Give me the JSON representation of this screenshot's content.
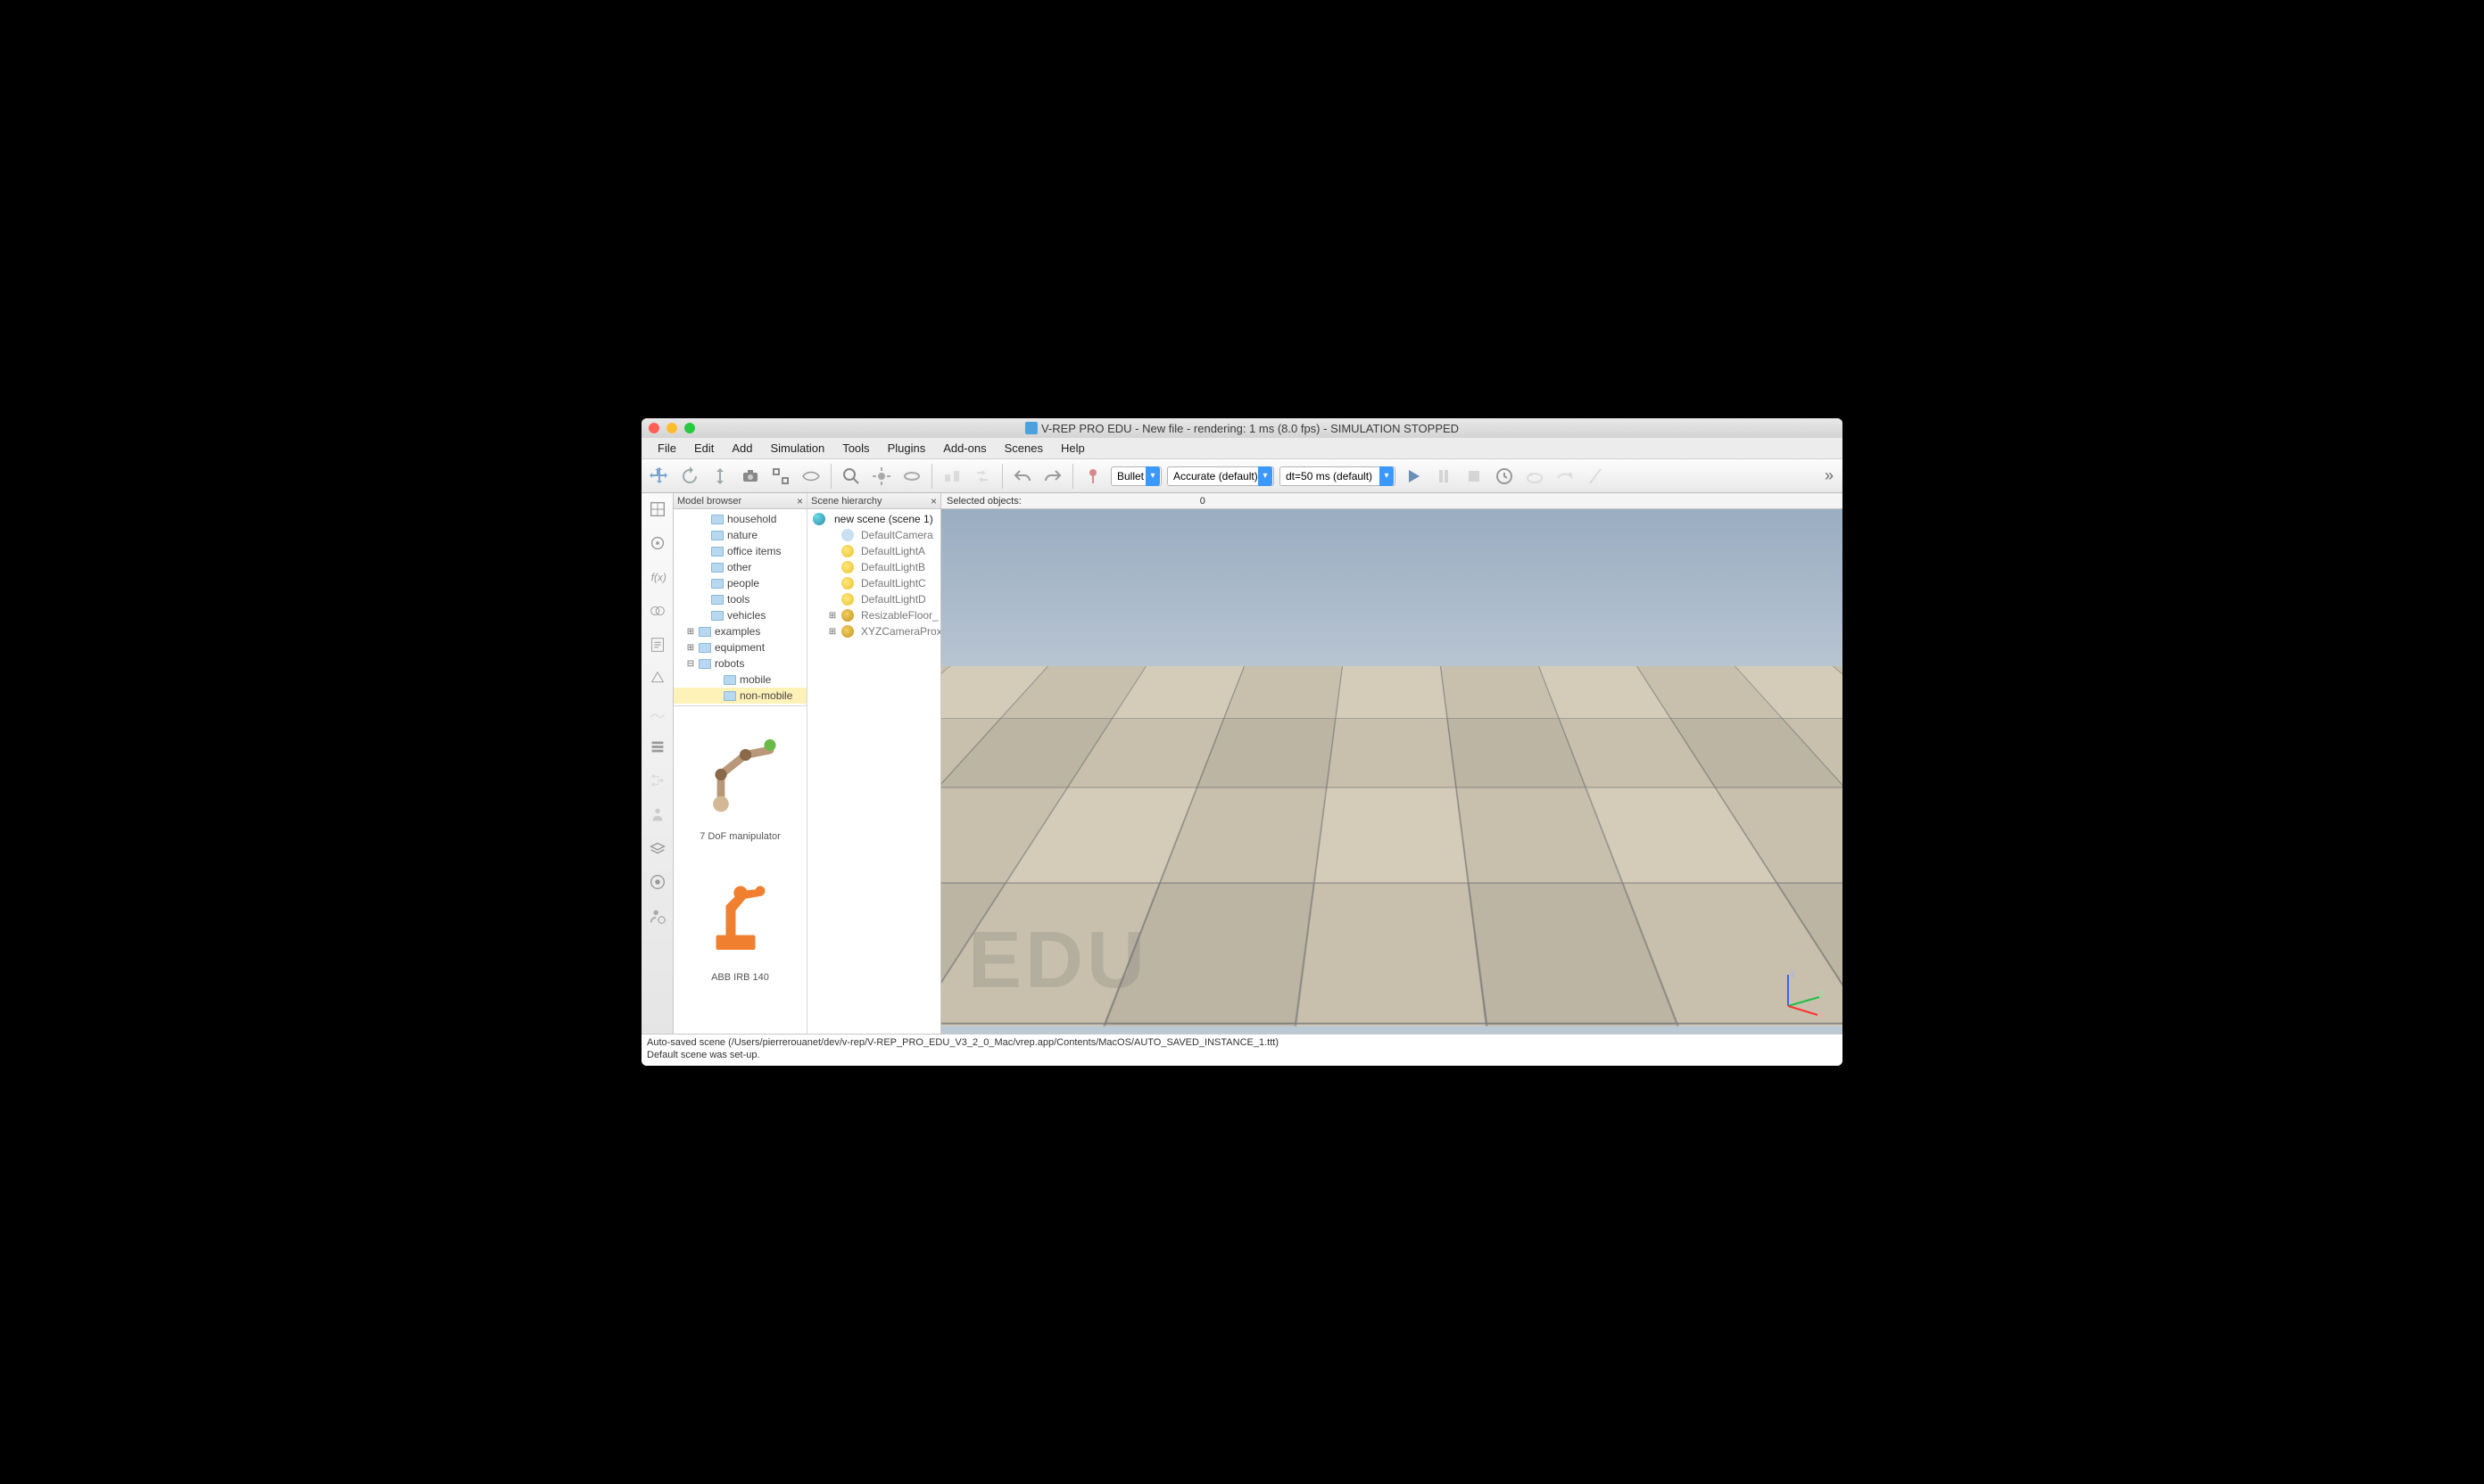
{
  "title": "V-REP PRO EDU - New file - rendering: 1 ms (8.0 fps) - SIMULATION STOPPED",
  "menu": [
    "File",
    "Edit",
    "Add",
    "Simulation",
    "Tools",
    "Plugins",
    "Add-ons",
    "Scenes",
    "Help"
  ],
  "toolbar": {
    "engine": "Bullet",
    "mode": "Accurate (default)",
    "dt": "dt=50 ms (default)"
  },
  "model_browser": {
    "title": "Model browser",
    "items": [
      {
        "label": "household",
        "indent": 1
      },
      {
        "label": "nature",
        "indent": 1
      },
      {
        "label": "office items",
        "indent": 1
      },
      {
        "label": "other",
        "indent": 1
      },
      {
        "label": "people",
        "indent": 1
      },
      {
        "label": "tools",
        "indent": 1
      },
      {
        "label": "vehicles",
        "indent": 1
      },
      {
        "label": "examples",
        "indent": 0,
        "exp": "⊞"
      },
      {
        "label": "equipment",
        "indent": 0,
        "exp": "⊞"
      },
      {
        "label": "robots",
        "indent": 0,
        "exp": "⊟"
      },
      {
        "label": "mobile",
        "indent": 2
      },
      {
        "label": "non-mobile",
        "indent": 2,
        "selected": true
      }
    ],
    "thumbs": [
      {
        "label": "7 DoF manipulator"
      },
      {
        "label": "ABB IRB 140"
      }
    ]
  },
  "scene_hierarchy": {
    "title": "Scene hierarchy",
    "root": "new scene (scene 1)",
    "items": [
      {
        "label": "DefaultCamera",
        "icon": "cam"
      },
      {
        "label": "DefaultLightA",
        "icon": "light"
      },
      {
        "label": "DefaultLightB",
        "icon": "light"
      },
      {
        "label": "DefaultLightC",
        "icon": "light"
      },
      {
        "label": "DefaultLightD",
        "icon": "light"
      },
      {
        "label": "ResizableFloor_",
        "icon": "floor",
        "exp": "⊞"
      },
      {
        "label": "XYZCameraProx",
        "icon": "floor",
        "exp": "⊞"
      }
    ]
  },
  "info_bar": {
    "label": "Selected objects:",
    "value": "0"
  },
  "watermark": "EDU",
  "axis": {
    "x": "x",
    "y": "y",
    "z": "z"
  },
  "console": {
    "line1": "Auto-saved scene (/Users/pierrerouanet/dev/v-rep/V-REP_PRO_EDU_V3_2_0_Mac/vrep.app/Contents/MacOS/AUTO_SAVED_INSTANCE_1.ttt)",
    "line2": "Default scene was set-up."
  }
}
